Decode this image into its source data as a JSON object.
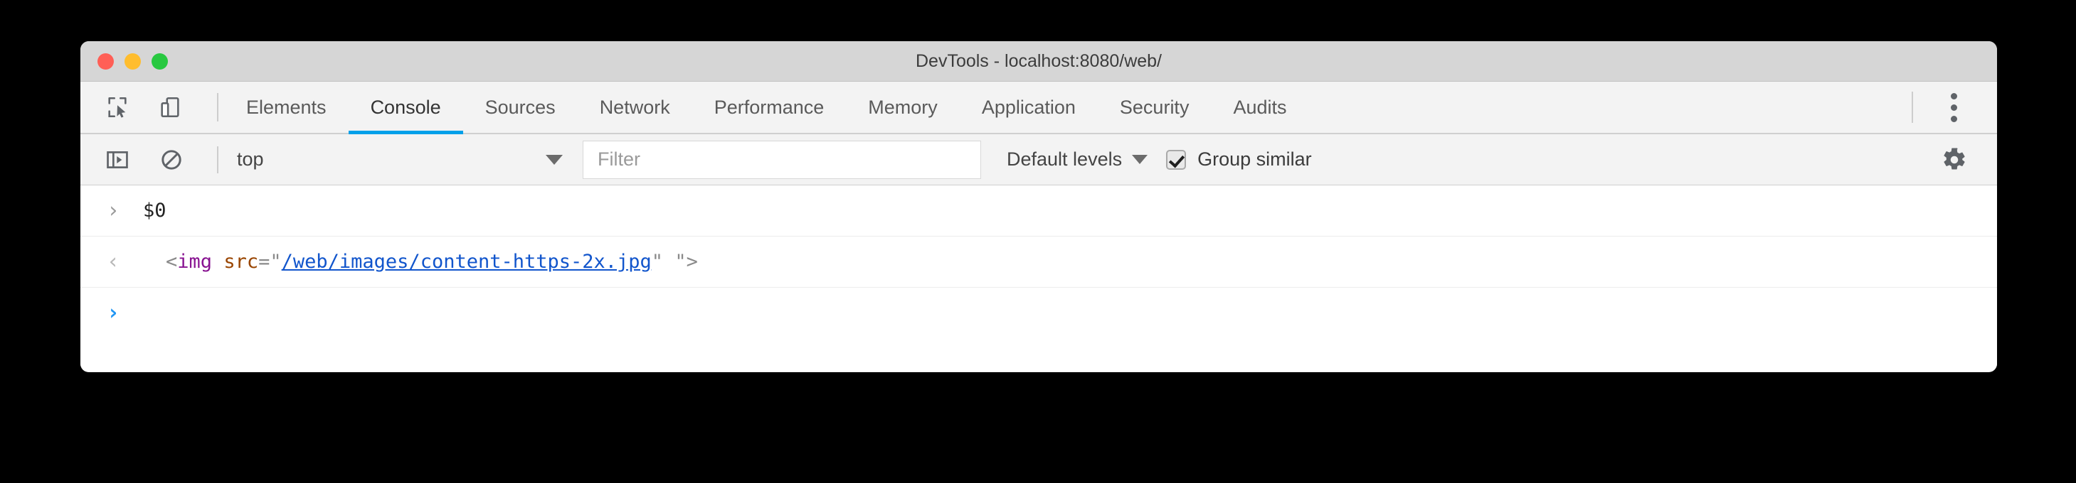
{
  "window": {
    "title": "DevTools - localhost:8080/web/",
    "traffic_lights": [
      {
        "name": "close",
        "color": "#ff5f56"
      },
      {
        "name": "minimize",
        "color": "#ffbd2e"
      },
      {
        "name": "zoom",
        "color": "#28c840"
      }
    ]
  },
  "tabbar": {
    "icons": [
      {
        "name": "inspect-element-icon",
        "title": "Inspect element"
      },
      {
        "name": "device-toolbar-icon",
        "title": "Toggle device toolbar"
      }
    ],
    "tabs": [
      {
        "label": "Elements",
        "active": false
      },
      {
        "label": "Console",
        "active": true
      },
      {
        "label": "Sources",
        "active": false
      },
      {
        "label": "Network",
        "active": false
      },
      {
        "label": "Performance",
        "active": false
      },
      {
        "label": "Memory",
        "active": false
      },
      {
        "label": "Application",
        "active": false
      },
      {
        "label": "Security",
        "active": false
      },
      {
        "label": "Audits",
        "active": false
      }
    ],
    "active_tab": "Console",
    "more_label": "More tools",
    "accent_color": "#00a0e9"
  },
  "toolbar": {
    "sidebar_toggle_title": "Show console sidebar",
    "clear_console_title": "Clear console",
    "context": {
      "value": "top",
      "caret": "▼"
    },
    "filter": {
      "value": "",
      "placeholder": "Filter"
    },
    "levels": {
      "label": "Default levels",
      "caret": "▼"
    },
    "group_similar": {
      "label": "Group similar",
      "checked": true
    },
    "settings_title": "Settings"
  },
  "console": {
    "rows": [
      {
        "type": "input",
        "gutter": "›",
        "gutter_name": "input-prompt-chevron-icon",
        "text": "$0"
      },
      {
        "type": "result",
        "gutter": "‹",
        "gutter_name": "output-return-chevron-icon",
        "tokens": [
          {
            "cls": "tok-punct",
            "text": "<"
          },
          {
            "cls": "tok-tag",
            "text": "img"
          },
          {
            "cls": "tok-punct",
            "text": " "
          },
          {
            "cls": "tok-attr",
            "text": "src"
          },
          {
            "cls": "tok-punct",
            "text": "="
          },
          {
            "cls": "tok-quote",
            "text": "\""
          },
          {
            "cls": "tok-link",
            "text": "/web/images/content-https-2x.jpg"
          },
          {
            "cls": "tok-quote",
            "text": "\""
          },
          {
            "cls": "tok-punct",
            "text": " "
          },
          {
            "cls": "tok-quote",
            "text": "\""
          },
          {
            "cls": "tok-punct",
            "text": ">"
          }
        ],
        "plain": "<img src=\"/web/images/content-https-2x.jpg\" \">"
      },
      {
        "type": "prompt",
        "gutter": "›",
        "gutter_name": "active-prompt-chevron-icon",
        "text": ""
      }
    ]
  }
}
